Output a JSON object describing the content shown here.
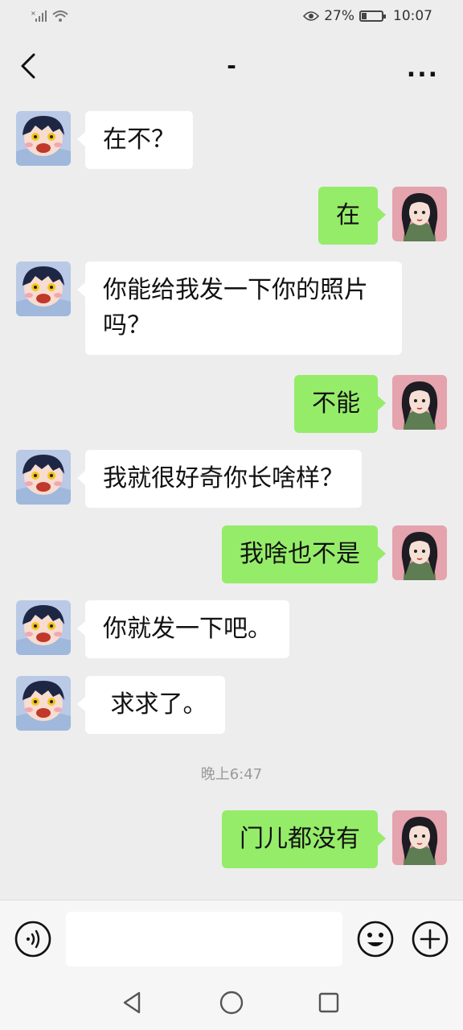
{
  "status_bar": {
    "battery_percent": "27%",
    "battery_level": 0.27,
    "time": "10:07"
  },
  "header": {
    "title": "-",
    "back_icon": "chevron-left-icon",
    "more_icon": "more-dots-icon",
    "more_label": "..."
  },
  "messages": [
    {
      "side": "left",
      "text": "在不？"
    },
    {
      "side": "right",
      "text": "在"
    },
    {
      "side": "left",
      "text": "你能给我发一下你的照片吗？"
    },
    {
      "side": "right",
      "text": "不能"
    },
    {
      "side": "left",
      "text": "我就很好奇你长啥样？"
    },
    {
      "side": "right",
      "text": "我啥也不是"
    },
    {
      "side": "left",
      "text": "你就发一下吧。"
    },
    {
      "side": "left",
      "text": " 求求了。"
    },
    {
      "side": "right",
      "text": "门儿都没有"
    }
  ],
  "timestamp": "晚上6:47",
  "input_bar": {
    "placeholder": "",
    "voice_icon": "voice-icon",
    "emoji_icon": "emoji-icon",
    "plus_icon": "plus-icon"
  },
  "nav_bar": {
    "back_icon": "triangle-back-icon",
    "home_icon": "circle-home-icon",
    "recents_icon": "square-recents-icon"
  },
  "colors": {
    "background": "#ededed",
    "sent_bubble": "#95ec69",
    "received_bubble": "#ffffff"
  }
}
